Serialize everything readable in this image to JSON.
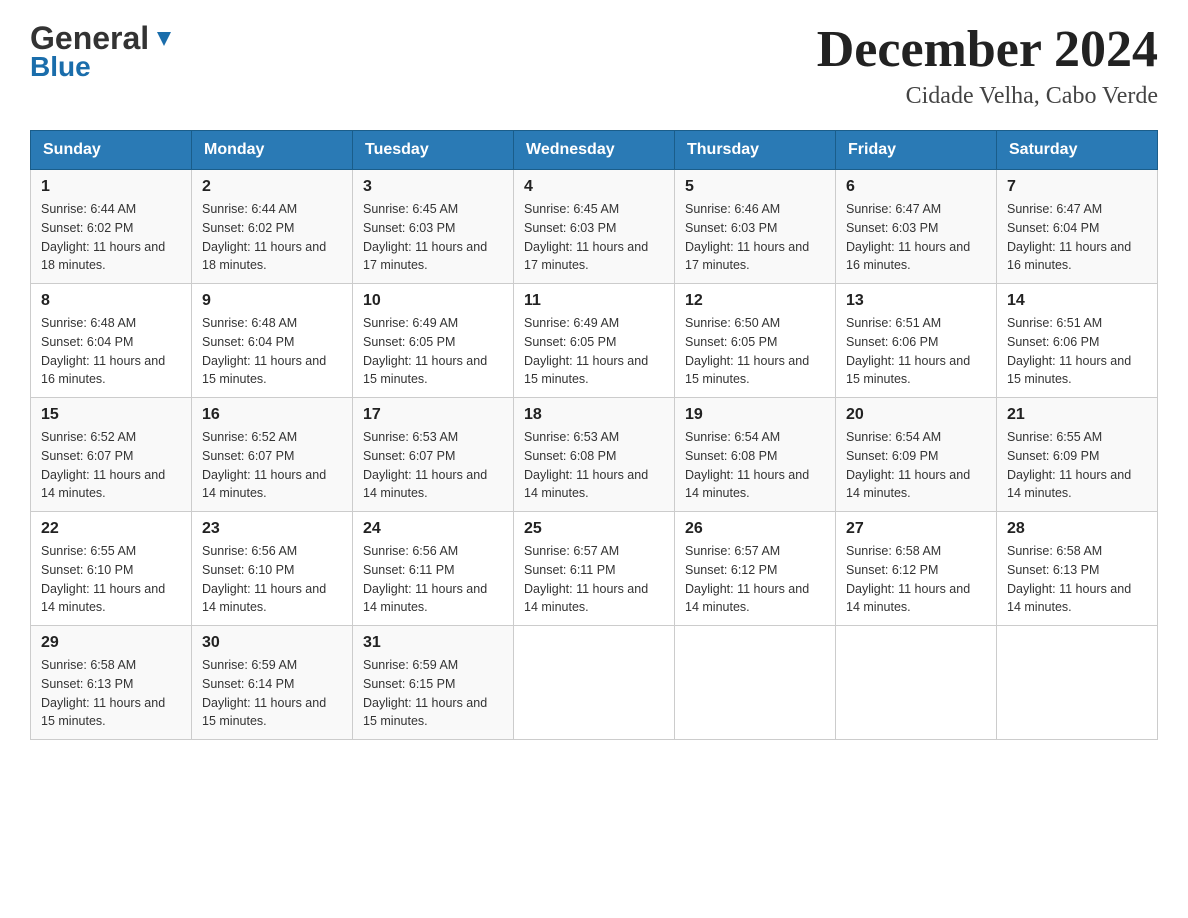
{
  "header": {
    "logo_general": "General",
    "logo_blue": "Blue",
    "month_title": "December 2024",
    "location": "Cidade Velha, Cabo Verde"
  },
  "days_of_week": [
    "Sunday",
    "Monday",
    "Tuesday",
    "Wednesday",
    "Thursday",
    "Friday",
    "Saturday"
  ],
  "weeks": [
    {
      "days": [
        {
          "number": "1",
          "sunrise": "Sunrise: 6:44 AM",
          "sunset": "Sunset: 6:02 PM",
          "daylight": "Daylight: 11 hours and 18 minutes."
        },
        {
          "number": "2",
          "sunrise": "Sunrise: 6:44 AM",
          "sunset": "Sunset: 6:02 PM",
          "daylight": "Daylight: 11 hours and 18 minutes."
        },
        {
          "number": "3",
          "sunrise": "Sunrise: 6:45 AM",
          "sunset": "Sunset: 6:03 PM",
          "daylight": "Daylight: 11 hours and 17 minutes."
        },
        {
          "number": "4",
          "sunrise": "Sunrise: 6:45 AM",
          "sunset": "Sunset: 6:03 PM",
          "daylight": "Daylight: 11 hours and 17 minutes."
        },
        {
          "number": "5",
          "sunrise": "Sunrise: 6:46 AM",
          "sunset": "Sunset: 6:03 PM",
          "daylight": "Daylight: 11 hours and 17 minutes."
        },
        {
          "number": "6",
          "sunrise": "Sunrise: 6:47 AM",
          "sunset": "Sunset: 6:03 PM",
          "daylight": "Daylight: 11 hours and 16 minutes."
        },
        {
          "number": "7",
          "sunrise": "Sunrise: 6:47 AM",
          "sunset": "Sunset: 6:04 PM",
          "daylight": "Daylight: 11 hours and 16 minutes."
        }
      ]
    },
    {
      "days": [
        {
          "number": "8",
          "sunrise": "Sunrise: 6:48 AM",
          "sunset": "Sunset: 6:04 PM",
          "daylight": "Daylight: 11 hours and 16 minutes."
        },
        {
          "number": "9",
          "sunrise": "Sunrise: 6:48 AM",
          "sunset": "Sunset: 6:04 PM",
          "daylight": "Daylight: 11 hours and 15 minutes."
        },
        {
          "number": "10",
          "sunrise": "Sunrise: 6:49 AM",
          "sunset": "Sunset: 6:05 PM",
          "daylight": "Daylight: 11 hours and 15 minutes."
        },
        {
          "number": "11",
          "sunrise": "Sunrise: 6:49 AM",
          "sunset": "Sunset: 6:05 PM",
          "daylight": "Daylight: 11 hours and 15 minutes."
        },
        {
          "number": "12",
          "sunrise": "Sunrise: 6:50 AM",
          "sunset": "Sunset: 6:05 PM",
          "daylight": "Daylight: 11 hours and 15 minutes."
        },
        {
          "number": "13",
          "sunrise": "Sunrise: 6:51 AM",
          "sunset": "Sunset: 6:06 PM",
          "daylight": "Daylight: 11 hours and 15 minutes."
        },
        {
          "number": "14",
          "sunrise": "Sunrise: 6:51 AM",
          "sunset": "Sunset: 6:06 PM",
          "daylight": "Daylight: 11 hours and 15 minutes."
        }
      ]
    },
    {
      "days": [
        {
          "number": "15",
          "sunrise": "Sunrise: 6:52 AM",
          "sunset": "Sunset: 6:07 PM",
          "daylight": "Daylight: 11 hours and 14 minutes."
        },
        {
          "number": "16",
          "sunrise": "Sunrise: 6:52 AM",
          "sunset": "Sunset: 6:07 PM",
          "daylight": "Daylight: 11 hours and 14 minutes."
        },
        {
          "number": "17",
          "sunrise": "Sunrise: 6:53 AM",
          "sunset": "Sunset: 6:07 PM",
          "daylight": "Daylight: 11 hours and 14 minutes."
        },
        {
          "number": "18",
          "sunrise": "Sunrise: 6:53 AM",
          "sunset": "Sunset: 6:08 PM",
          "daylight": "Daylight: 11 hours and 14 minutes."
        },
        {
          "number": "19",
          "sunrise": "Sunrise: 6:54 AM",
          "sunset": "Sunset: 6:08 PM",
          "daylight": "Daylight: 11 hours and 14 minutes."
        },
        {
          "number": "20",
          "sunrise": "Sunrise: 6:54 AM",
          "sunset": "Sunset: 6:09 PM",
          "daylight": "Daylight: 11 hours and 14 minutes."
        },
        {
          "number": "21",
          "sunrise": "Sunrise: 6:55 AM",
          "sunset": "Sunset: 6:09 PM",
          "daylight": "Daylight: 11 hours and 14 minutes."
        }
      ]
    },
    {
      "days": [
        {
          "number": "22",
          "sunrise": "Sunrise: 6:55 AM",
          "sunset": "Sunset: 6:10 PM",
          "daylight": "Daylight: 11 hours and 14 minutes."
        },
        {
          "number": "23",
          "sunrise": "Sunrise: 6:56 AM",
          "sunset": "Sunset: 6:10 PM",
          "daylight": "Daylight: 11 hours and 14 minutes."
        },
        {
          "number": "24",
          "sunrise": "Sunrise: 6:56 AM",
          "sunset": "Sunset: 6:11 PM",
          "daylight": "Daylight: 11 hours and 14 minutes."
        },
        {
          "number": "25",
          "sunrise": "Sunrise: 6:57 AM",
          "sunset": "Sunset: 6:11 PM",
          "daylight": "Daylight: 11 hours and 14 minutes."
        },
        {
          "number": "26",
          "sunrise": "Sunrise: 6:57 AM",
          "sunset": "Sunset: 6:12 PM",
          "daylight": "Daylight: 11 hours and 14 minutes."
        },
        {
          "number": "27",
          "sunrise": "Sunrise: 6:58 AM",
          "sunset": "Sunset: 6:12 PM",
          "daylight": "Daylight: 11 hours and 14 minutes."
        },
        {
          "number": "28",
          "sunrise": "Sunrise: 6:58 AM",
          "sunset": "Sunset: 6:13 PM",
          "daylight": "Daylight: 11 hours and 14 minutes."
        }
      ]
    },
    {
      "days": [
        {
          "number": "29",
          "sunrise": "Sunrise: 6:58 AM",
          "sunset": "Sunset: 6:13 PM",
          "daylight": "Daylight: 11 hours and 15 minutes."
        },
        {
          "number": "30",
          "sunrise": "Sunrise: 6:59 AM",
          "sunset": "Sunset: 6:14 PM",
          "daylight": "Daylight: 11 hours and 15 minutes."
        },
        {
          "number": "31",
          "sunrise": "Sunrise: 6:59 AM",
          "sunset": "Sunset: 6:15 PM",
          "daylight": "Daylight: 11 hours and 15 minutes."
        },
        null,
        null,
        null,
        null
      ]
    }
  ]
}
